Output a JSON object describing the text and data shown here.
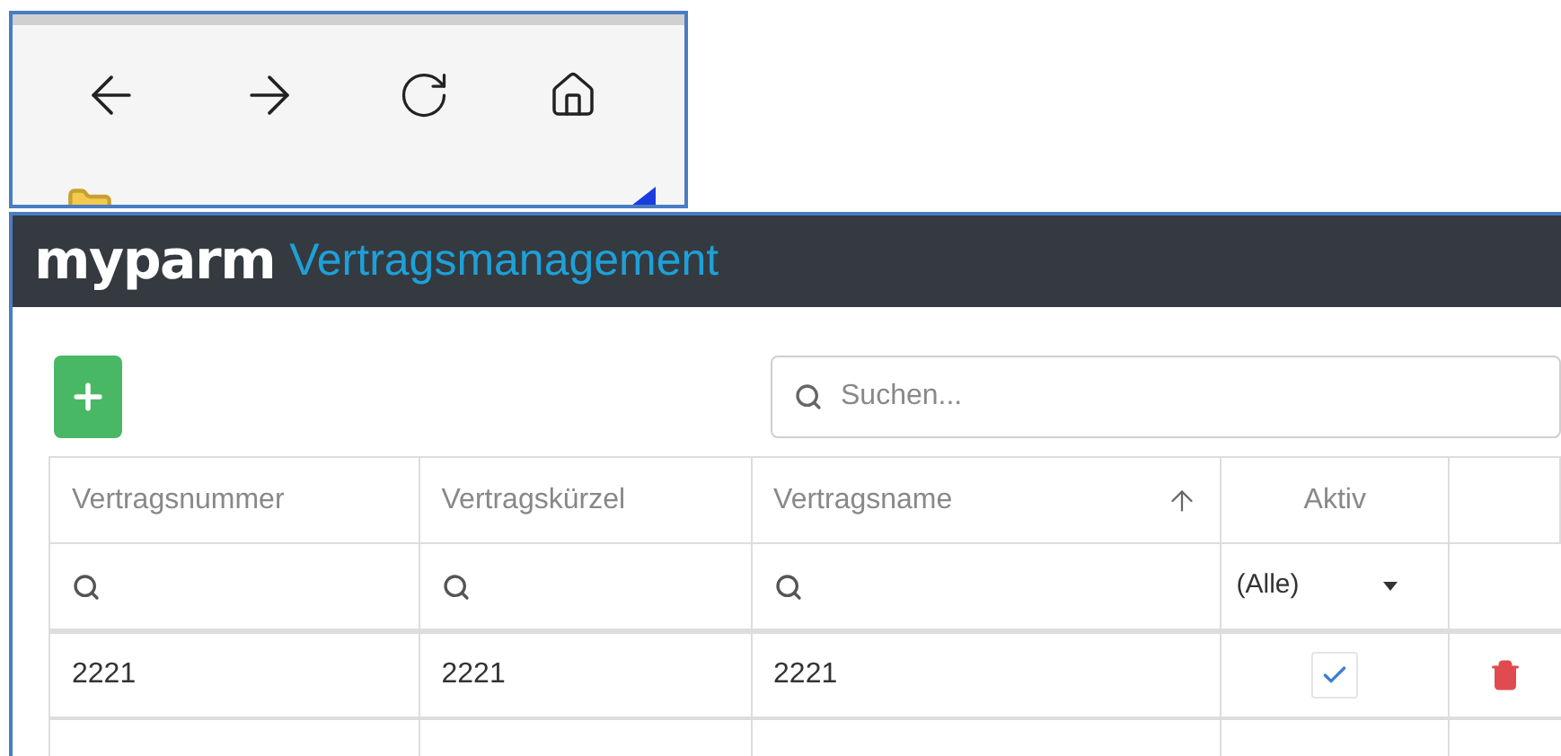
{
  "app": {
    "logo": "myparm",
    "title": "Vertragsmanagement"
  },
  "search": {
    "placeholder": "Suchen..."
  },
  "table": {
    "columns": [
      {
        "label": "Vertragsnummer",
        "kind": "text"
      },
      {
        "label": "Vertragskürzel",
        "kind": "text"
      },
      {
        "label": "Vertragsname",
        "kind": "text",
        "sorted": true
      },
      {
        "label": "Aktiv",
        "kind": "check",
        "filter": "(Alle)"
      },
      {
        "kind": "action"
      }
    ],
    "rows": [
      {
        "cells": [
          "2221",
          "2221",
          "2221"
        ],
        "active": true
      }
    ]
  }
}
